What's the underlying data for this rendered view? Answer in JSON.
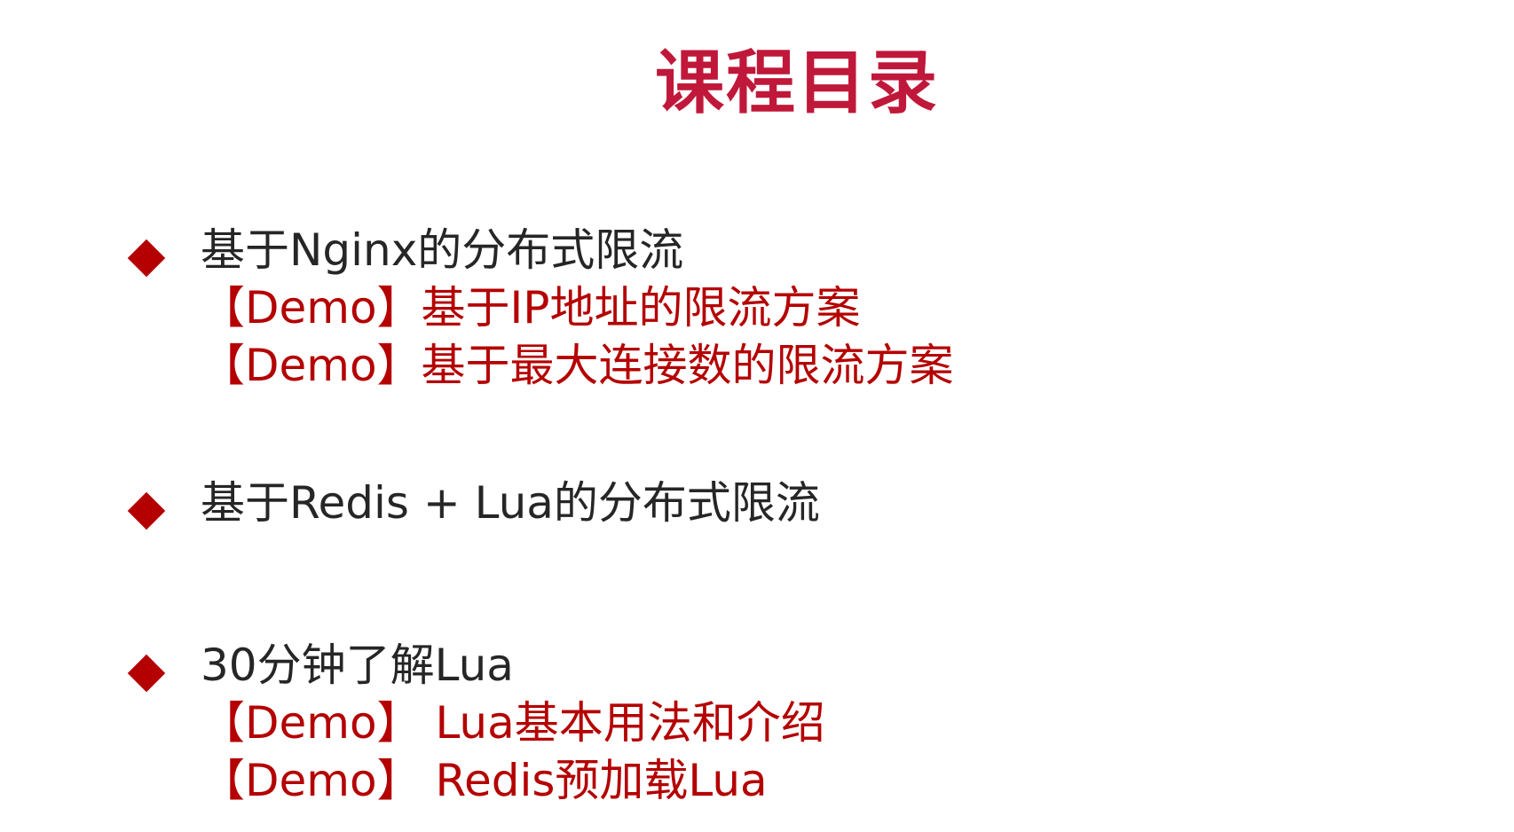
{
  "title": "课程目录",
  "colors": {
    "title": "#c0183a",
    "bullet": "#b40000",
    "main_text": "#262626",
    "demo_text": "#b40000"
  },
  "sections": [
    {
      "heading": "基于Nginx的分布式限流",
      "items": [
        "【Demo】基于IP地址的限流方案",
        "【Demo】基于最大连接数的限流方案"
      ]
    },
    {
      "heading": "基于Redis + Lua的分布式限流",
      "items": []
    },
    {
      "heading": "30分钟了解Lua",
      "items": [
        "【Demo】 Lua基本用法和介绍",
        "【Demo】 Redis预加载Lua"
      ]
    }
  ]
}
